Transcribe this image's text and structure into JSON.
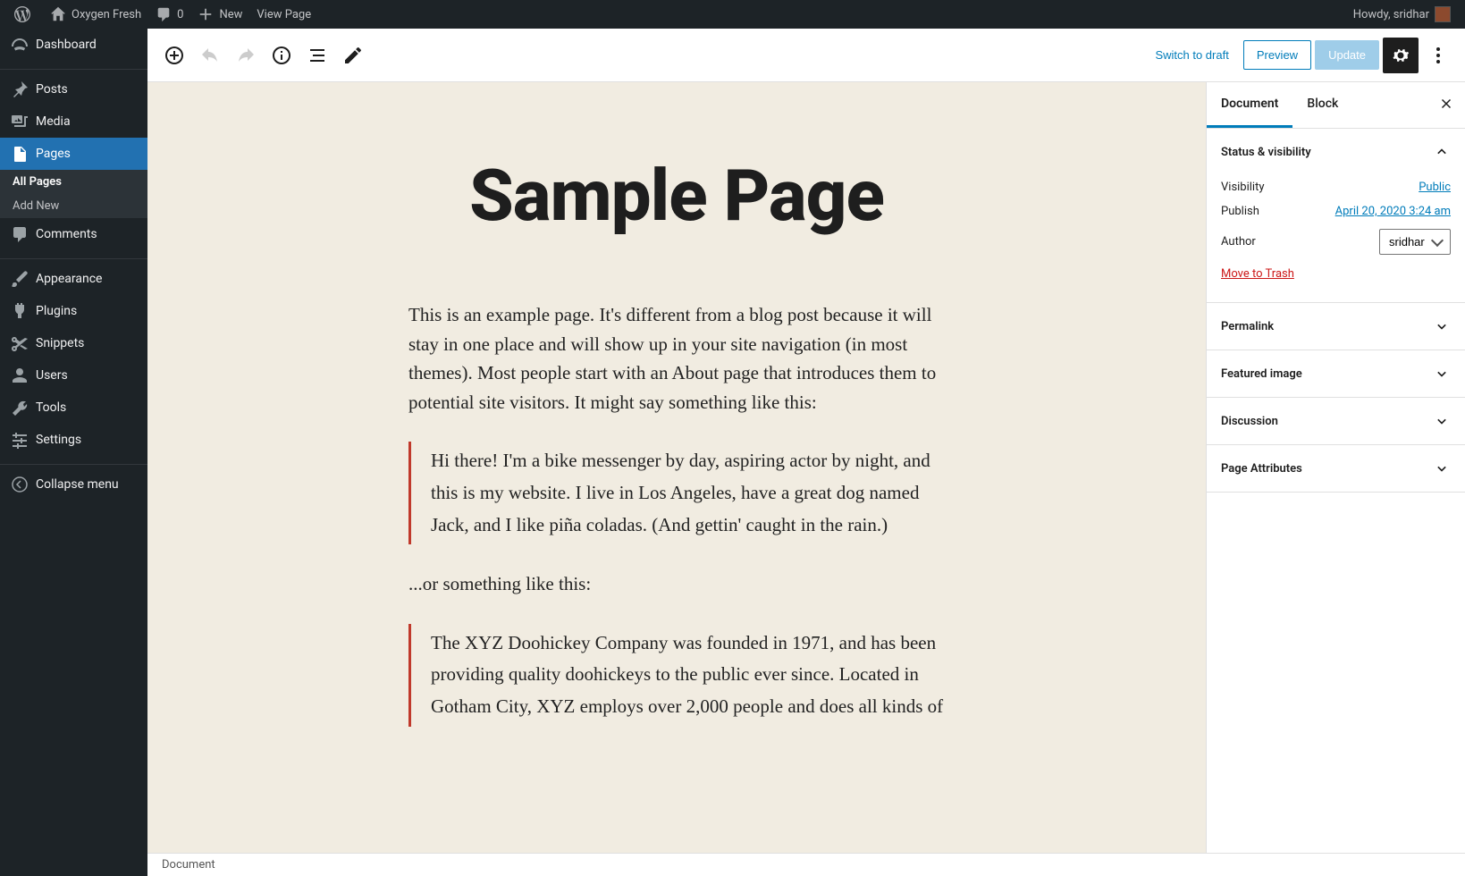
{
  "adminbar": {
    "site_name": "Oxygen Fresh",
    "comments_count": "0",
    "new_label": "New",
    "view_page": "View Page",
    "howdy": "Howdy, sridhar"
  },
  "adminmenu": {
    "dashboard": "Dashboard",
    "posts": "Posts",
    "media": "Media",
    "pages": "Pages",
    "comments": "Comments",
    "appearance": "Appearance",
    "plugins": "Plugins",
    "snippets": "Snippets",
    "users": "Users",
    "tools": "Tools",
    "settings": "Settings",
    "collapse": "Collapse menu",
    "submenu": {
      "all_pages": "All Pages",
      "add_new": "Add New"
    }
  },
  "editor": {
    "switch_to_draft": "Switch to draft",
    "preview": "Preview",
    "update": "Update"
  },
  "content": {
    "title": "Sample Page",
    "para1": "This is an example page. It's different from a blog post because it will stay in one place and will show up in your site navigation (in most themes). Most people start with an About page that introduces them to potential site visitors. It might say something like this:",
    "quote1": "Hi there! I'm a bike messenger by day, aspiring actor by night, and this is my website. I live in Los Angeles, have a great dog named Jack, and I like piña coladas. (And gettin' caught in the rain.)",
    "para2": "...or something like this:",
    "quote2": "The XYZ Doohickey Company was founded in 1971, and has been providing quality doohickeys to the public ever since. Located in Gotham City, XYZ employs over 2,000 people and does all kinds of"
  },
  "sidebar": {
    "tabs": {
      "document": "Document",
      "block": "Block"
    },
    "panels": {
      "status": "Status & visibility",
      "permalink": "Permalink",
      "featured": "Featured image",
      "discussion": "Discussion",
      "attributes": "Page Attributes"
    },
    "status": {
      "visibility_label": "Visibility",
      "visibility_value": "Public",
      "publish_label": "Publish",
      "publish_value": "April 20, 2020 3:24 am",
      "author_label": "Author",
      "author_value": "sridhar",
      "trash": "Move to Trash"
    }
  },
  "footer": {
    "breadcrumb": "Document"
  }
}
